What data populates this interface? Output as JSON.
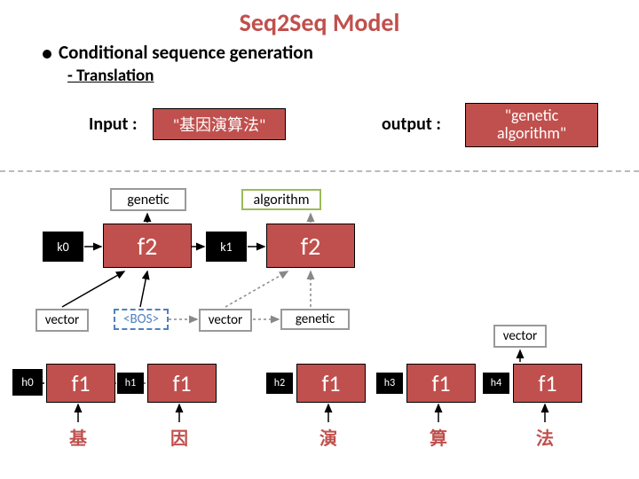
{
  "title": "Seq2Seq Model",
  "bullet": "Conditional sequence generation",
  "subline": "- Translation",
  "input_label": "Input :",
  "output_label": "output :",
  "input_box": "\"基因演算法\"",
  "output_box": "\"genetic algorithm\"",
  "top": {
    "genetic": "genetic",
    "algorithm": "algorithm"
  },
  "state": {
    "k0": "k0",
    "k1": "k1"
  },
  "f2": "f2",
  "vector": "vector",
  "bos": "<BOS>",
  "genetic_token": "genetic",
  "h": {
    "h0": "h0",
    "h1": "h1",
    "h2": "h2",
    "h3": "h3",
    "h4": "h4"
  },
  "f1": "f1",
  "cn": {
    "c1": "基",
    "c2": "因",
    "c3": "演",
    "c4": "算",
    "c5": "法"
  }
}
